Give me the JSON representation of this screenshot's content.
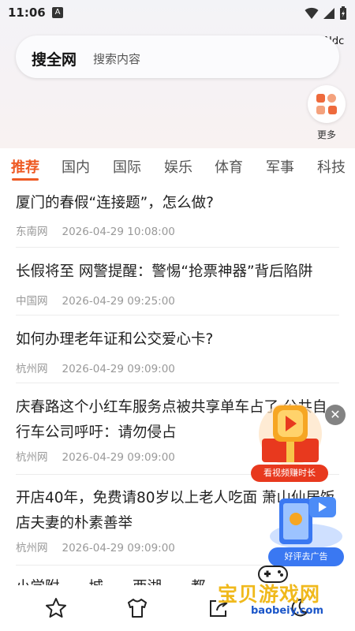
{
  "status_bar": {
    "time": "11:06",
    "notif_icon": "A"
  },
  "header": {
    "corner_text": "tNdc",
    "search": {
      "brand": "搜全网",
      "placeholder": "搜索内容"
    },
    "more_label": "更多"
  },
  "tabs": [
    {
      "label": "推荐",
      "active": true
    },
    {
      "label": "国内"
    },
    {
      "label": "国际"
    },
    {
      "label": "娱乐"
    },
    {
      "label": "体育"
    },
    {
      "label": "军事"
    },
    {
      "label": "科技"
    }
  ],
  "news": [
    {
      "title": "厦门的春假“连接题”，怎么做?",
      "source": "东南网",
      "time": "2026-04-29 10:08:00"
    },
    {
      "title": "长假将至 网警提醒：警惕“抢票神器”背后陷阱",
      "source": "中国网",
      "time": "2026-04-29 09:25:00"
    },
    {
      "title": "如何办理老年证和公交爱心卡?",
      "source": "杭州网",
      "time": "2026-04-29 09:09:00"
    },
    {
      "title": "庆春路这个小红车服务点被共享单车占了 公共自行车公司呼吁：请勿侵占",
      "source": "杭州网",
      "time": "2026-04-29 09:09:00"
    },
    {
      "title": "开店40年，免费请80岁以上老人吃面 萧山仙居饭店夫妻的朴素善举",
      "source": "杭州网",
      "time": "2026-04-29 09:09:00"
    },
    {
      "title": "小学附……城……西湖……都……",
      "source": "",
      "time": ""
    }
  ],
  "float_ads": {
    "video_label": "看视频赚时长",
    "rate_label": "好评去广告",
    "close": "✕"
  },
  "watermark": {
    "title": "宝贝游戏网",
    "url": "baobeiy.com"
  },
  "bottom_nav": [
    "star-icon",
    "shirt-icon",
    "share-icon",
    "moon-icon"
  ],
  "colors": {
    "accent": "#ee5a24",
    "ad_red": "#e8391e",
    "ad_blue": "#3a78f2"
  }
}
